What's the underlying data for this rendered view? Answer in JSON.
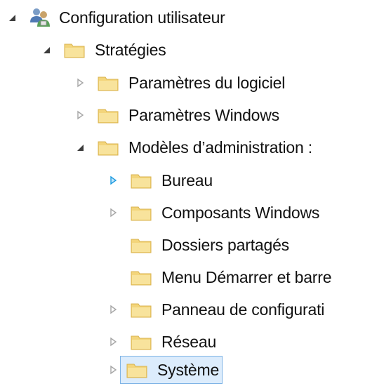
{
  "tree": {
    "root": {
      "label": "Configuration utilisateur",
      "icon": "users-group-icon",
      "expanded": true
    },
    "items": [
      {
        "label": "Stratégies",
        "icon": "folder-icon",
        "expander": "expanded"
      },
      {
        "label": "Paramètres du logiciel",
        "icon": "folder-icon",
        "expander": "collapsed"
      },
      {
        "label": "Paramètres Windows",
        "icon": "folder-icon",
        "expander": "collapsed"
      },
      {
        "label": "Modèles d’administration :",
        "icon": "folder-icon",
        "expander": "expanded"
      },
      {
        "label": "Bureau",
        "icon": "folder-icon",
        "expander": "collapsed-hover"
      },
      {
        "label": "Composants Windows",
        "icon": "folder-icon",
        "expander": "collapsed"
      },
      {
        "label": "Dossiers partagés",
        "icon": "folder-icon",
        "expander": "none"
      },
      {
        "label": "Menu Démarrer et barre",
        "icon": "folder-icon",
        "expander": "none"
      },
      {
        "label": "Panneau de configurati",
        "icon": "folder-icon",
        "expander": "collapsed"
      },
      {
        "label": "Réseau",
        "icon": "folder-icon",
        "expander": "collapsed"
      },
      {
        "label": "Système",
        "icon": "folder-icon",
        "expander": "collapsed",
        "selected": true
      }
    ]
  },
  "colors": {
    "expander_expanded": "#3c3c3c",
    "expander_collapsed": "#a6a6a6",
    "expander_hover": "#1e9be0",
    "folder_fill": "#f3d57b",
    "folder_edge": "#d8b24c",
    "selection_bg": "#dcecfc",
    "selection_border": "#7fb4e6"
  }
}
